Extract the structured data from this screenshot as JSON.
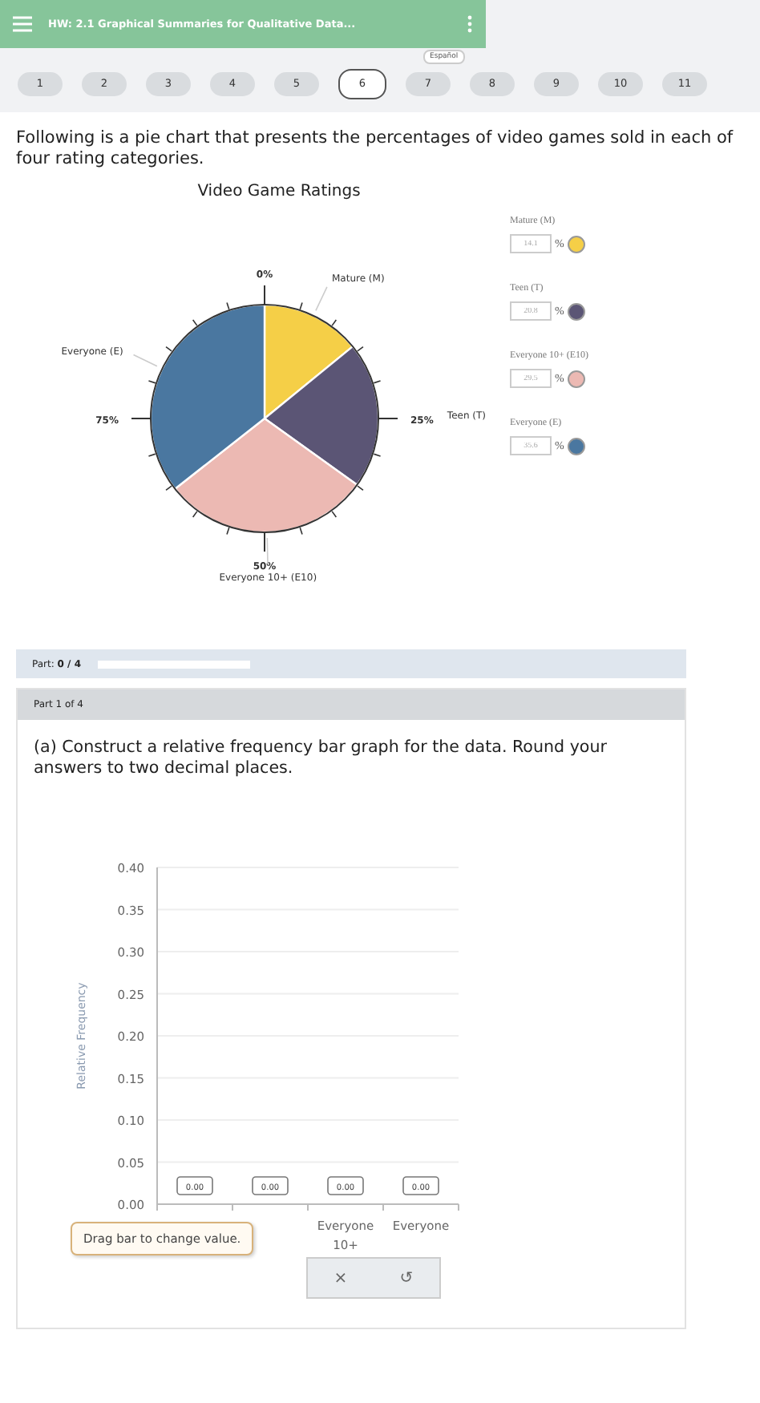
{
  "header": {
    "title": "HW: 2.1 Graphical Summaries for Qualitative Data..."
  },
  "questions": [
    {
      "label": "1",
      "selected": false
    },
    {
      "label": "2",
      "selected": false
    },
    {
      "label": "3",
      "selected": false
    },
    {
      "label": "4",
      "selected": false
    },
    {
      "label": "5",
      "selected": false
    },
    {
      "label": "6",
      "selected": true
    },
    {
      "label": "7",
      "selected": false
    },
    {
      "label": "8",
      "selected": false
    },
    {
      "label": "9",
      "selected": false
    },
    {
      "label": "10",
      "selected": false
    },
    {
      "label": "11",
      "selected": false
    }
  ],
  "language_badge": "Español",
  "intro": "Following is a pie chart that presents the percentages of video games sold in each of four rating categories.",
  "pie": {
    "chart_data": {
      "type": "pie",
      "title": "Video Game Ratings",
      "categories": [
        "Mature (M)",
        "Teen (T)",
        "Everyone 10+ (E10)",
        "Everyone (E)"
      ],
      "values": [
        14.1,
        20.8,
        29.5,
        35.6
      ],
      "colors": [
        "#f5cf47",
        "#5b5575",
        "#ecb9b3",
        "#4a77a0"
      ]
    },
    "scale_labels": [
      "0%",
      "25%",
      "50%",
      "75%"
    ],
    "legend": [
      {
        "label": "Mature (M)",
        "value": "14.1",
        "unit": "%",
        "color": "#f5cf47"
      },
      {
        "label": "Teen (T)",
        "value": "20.8",
        "unit": "%",
        "color": "#5b5575"
      },
      {
        "label": "Everyone 10+ (E10)",
        "value": "29.5",
        "unit": "%",
        "color": "#ecb9b3"
      },
      {
        "label": "Everyone (E)",
        "value": "35.6",
        "unit": "%",
        "color": "#4a77a0"
      }
    ]
  },
  "progress": {
    "label": "Part: **0 / 4**",
    "level": 0
  },
  "part": {
    "title": "Part 1 of 4",
    "question": "(a) Construct a relative frequency bar graph for the data. Round your answers to two decimal places.",
    "chart_data": {
      "type": "bar",
      "ylabel": "Relative Frequency",
      "categories": [
        null,
        null,
        "Everyone 10+",
        "Everyone"
      ],
      "values": [
        0,
        0,
        0,
        0
      ],
      "ylim": [
        0,
        0.4
      ],
      "grid": true,
      "yticks": [
        {
          "value": 0,
          "label": "0.00"
        },
        {
          "value": 0.05,
          "label": "0.05"
        },
        {
          "value": 0.1,
          "label": "0.10"
        },
        {
          "value": 0.15,
          "label": "0.15"
        },
        {
          "value": 0.2,
          "label": "0.20"
        },
        {
          "value": 0.25,
          "label": "0.25"
        },
        {
          "value": 0.3,
          "label": "0.30"
        },
        {
          "value": 0.35,
          "label": "0.35"
        },
        {
          "value": 0.4,
          "label": "0.40"
        }
      ],
      "value_labels": [
        "0.00",
        "0.00",
        "0.00",
        "0.00"
      ]
    },
    "tooltip": "Drag bar to change value.",
    "actions": [
      "×",
      "↺"
    ]
  }
}
